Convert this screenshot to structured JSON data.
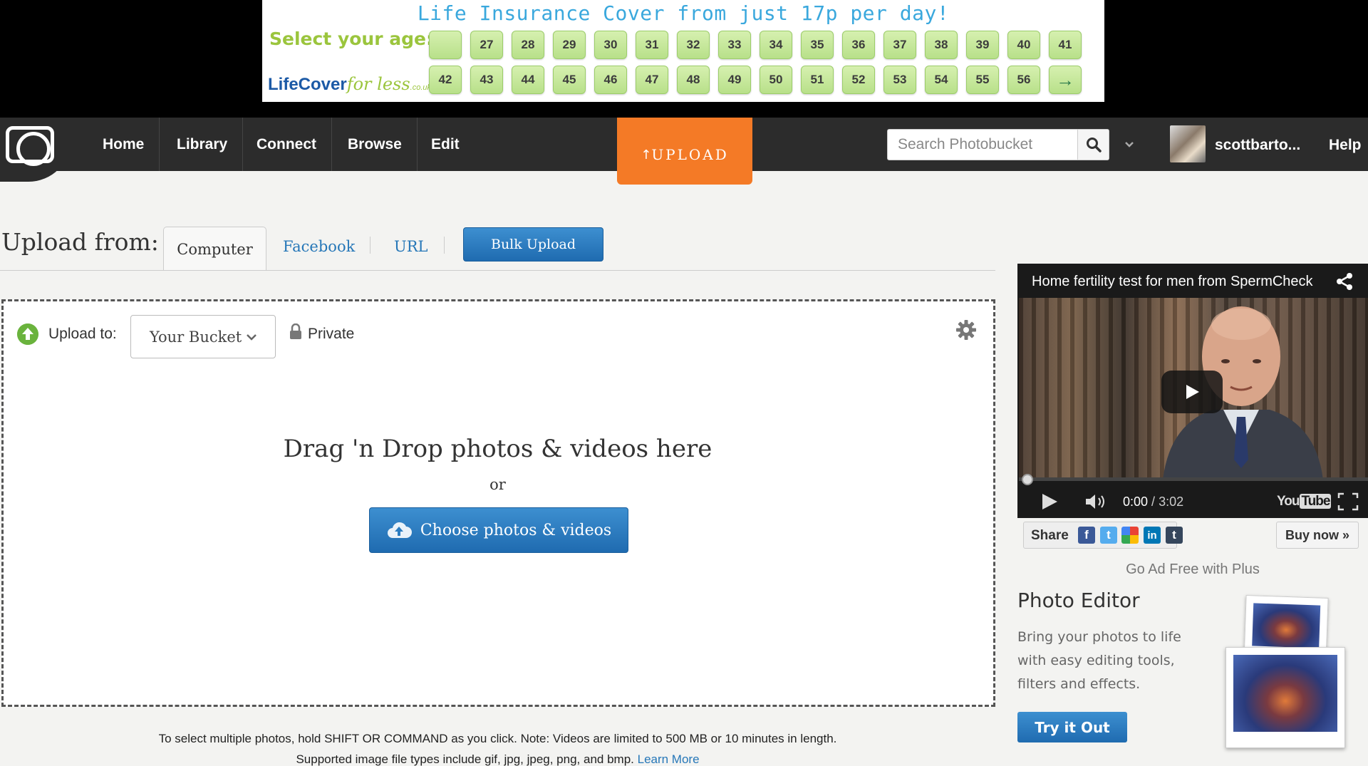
{
  "ad": {
    "headline": "Life Insurance Cover from just 17p per day!",
    "select_label": "Select your age:",
    "logo_main": "LifeCover",
    "logo_for": "for less",
    "logo_suffix": ".co.uk",
    "row1": [
      "",
      "27",
      "28",
      "29",
      "30",
      "31",
      "32",
      "33",
      "34",
      "35",
      "36",
      "37",
      "38",
      "39",
      "40",
      "41"
    ],
    "row2": [
      "42",
      "43",
      "44",
      "45",
      "46",
      "47",
      "48",
      "49",
      "50",
      "51",
      "52",
      "53",
      "54",
      "55",
      "56",
      "→"
    ]
  },
  "nav": {
    "items": [
      "Home",
      "Library",
      "Connect",
      "Browse",
      "Edit"
    ],
    "upload": "UPLOAD",
    "search_placeholder": "Search Photobucket",
    "username": "scottbarto...",
    "help": "Help"
  },
  "upload": {
    "from_label": "Upload from:",
    "tabs": [
      "Computer",
      "Facebook",
      "URL"
    ],
    "bulk": "Bulk Upload",
    "to_label": "Upload to:",
    "bucket": "Your Bucket",
    "privacy": "Private",
    "drag": "Drag 'n Drop photos & videos here",
    "or": "or",
    "choose": "Choose photos & videos",
    "note1": "To select multiple photos, hold SHIFT OR COMMAND as you click. Note: Videos are limited to 500 MB or 10 minutes in length.",
    "note2": "Supported image file types include gif, jpg, jpeg, png, and bmp.",
    "learn_more": "Learn More"
  },
  "video": {
    "title": "Home fertility test for men from SpermCheck",
    "current": "0:00",
    "total": "3:02",
    "yt_you": "You",
    "yt_tube": "Tube",
    "share": "Share",
    "buy": "Buy now »",
    "progress": 0
  },
  "promo": {
    "adfree": "Go Ad Free with Plus",
    "title": "Photo Editor",
    "desc": "Bring your photos to life with easy editing tools, filters and effects.",
    "cta": "Try it Out"
  },
  "colors": {
    "accent_orange": "#f47a26",
    "button_blue": "#2677b8",
    "nav_bg": "#2c2c2c"
  }
}
